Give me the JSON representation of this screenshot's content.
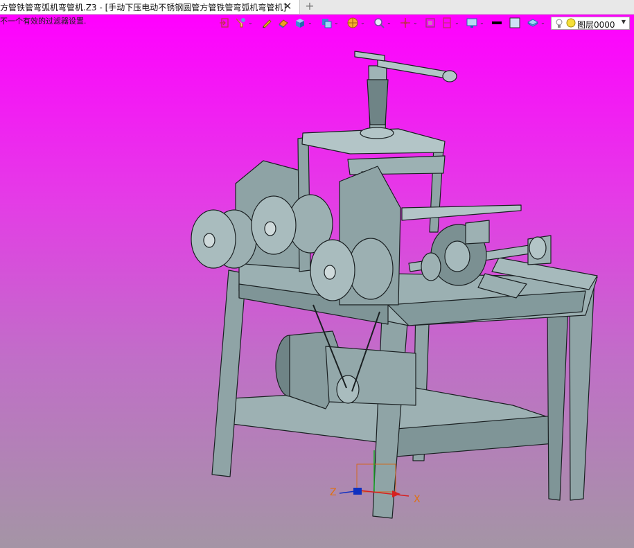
{
  "tab": {
    "title": "方管铁管弯弧机弯管机.Z3 - [手动下压电动不锈钢圆管方管铁管弯弧机弯管机]",
    "close_glyph": "✕",
    "new_tab_glyph": "+"
  },
  "status": {
    "hint": "不一个有效的过滤器设置."
  },
  "toolbar": {
    "icons": [
      "exit-icon",
      "filter-select-icon",
      "pen-icon",
      "eraser-icon",
      "cube-display-icon",
      "view-orient-icon",
      "render-mode-icon",
      "zoom-icon",
      "pan-icon",
      "fit-screen-icon",
      "section-icon",
      "monitor-icon",
      "line-style-icon",
      "color-swatch-icon",
      "layer-manager-icon"
    ]
  },
  "layer": {
    "value": "图层0000"
  },
  "axes": {
    "x_label": "X",
    "z_label": "Z"
  },
  "colors": {
    "viewport_top": "#ff00ff",
    "viewport_bottom": "#a495a5",
    "model_fill": "#8fa4a6",
    "model_edge": "#1a2022"
  }
}
